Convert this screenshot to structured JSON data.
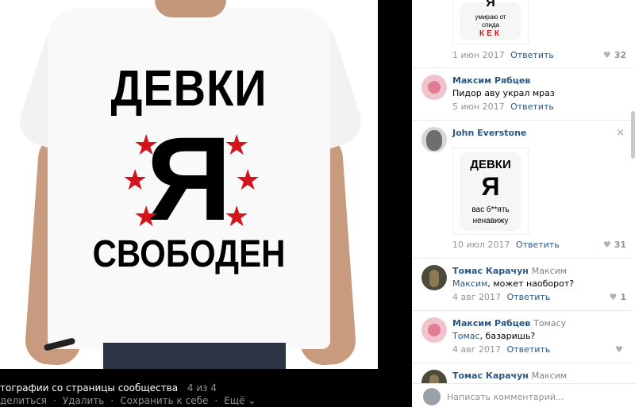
{
  "photo": {
    "shirt_text": {
      "line1": "ДЕВКИ",
      "line2": "Я",
      "line3": "СВОБОДЕН",
      "star": "★"
    },
    "caption": "тографии со страницы сообщества",
    "counter": "4 из 4",
    "actions": {
      "share": "делиться",
      "delete": "Удалить",
      "save": "Сохранить к себе",
      "more": "Ещё"
    }
  },
  "comments": [
    {
      "thumb_lines": [
        "Я",
        "умираю от",
        "спида",
        "КЕК"
      ],
      "date": "1 июн 2017",
      "reply": "Ответить",
      "likes": "32"
    },
    {
      "author": "Максим Рябцев",
      "text": "Пидор аву украл мраз",
      "date": "5 июн 2017",
      "reply": "Ответить"
    },
    {
      "author": "John Everstone",
      "close": "×",
      "thumb_lines": [
        "ДЕВКИ",
        "Я",
        "вас б**ять",
        "ненавижу"
      ],
      "date": "10 июл 2017",
      "reply": "Ответить",
      "likes": "31"
    },
    {
      "author": "Томас Карачун",
      "reply_to": "Максим",
      "mention": "Максим",
      "text": ", может наоборот?",
      "date": "4 авг 2017",
      "reply": "Ответить",
      "likes": "1"
    },
    {
      "author": "Максим Рябцев",
      "reply_to": "Томасу",
      "mention": "Томас",
      "text": ", базаришь?",
      "date": "4 авг 2017",
      "reply": "Ответить"
    },
    {
      "author": "Томас Карачун",
      "reply_to": "Максим"
    }
  ],
  "input": {
    "placeholder": "Написать комментарий..."
  },
  "colors": {
    "link": "#2a5885",
    "muted": "#939393",
    "star": "#d4141b"
  },
  "icons": {
    "like": "heart-icon",
    "close": "close-icon",
    "more": "chevron-down-icon"
  }
}
